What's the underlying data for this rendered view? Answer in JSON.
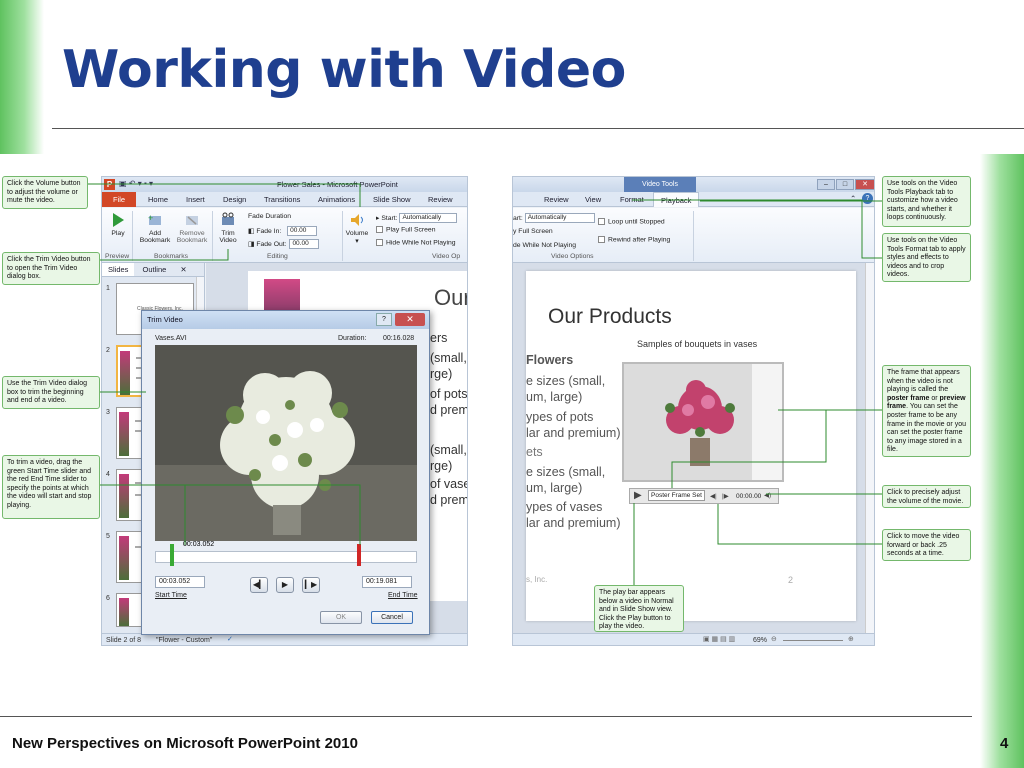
{
  "slide": {
    "title": "Working with Video",
    "footer": "New Perspectives on Microsoft PowerPoint 2010",
    "page_number": "4"
  },
  "left_window": {
    "title": "Flower Sales - Microsoft PowerPoint",
    "tabs": [
      "File",
      "Home",
      "Insert",
      "Design",
      "Transitions",
      "Animations",
      "Slide Show",
      "Review"
    ],
    "ribbon": {
      "play": "Play",
      "add_bookmark": [
        "Add",
        "Bookmark"
      ],
      "remove_bookmark": [
        "Remove",
        "Bookmark"
      ],
      "trim_video": [
        "Trim",
        "Video"
      ],
      "fade_duration": "Fade Duration",
      "fade_in": "Fade In:",
      "fade_in_value": "00.00",
      "fade_out": "Fade Out:",
      "fade_out_value": "00.00",
      "volume": "Volume",
      "start": "Start:",
      "start_value": "Automatically",
      "play_full_screen": "Play Full Screen",
      "hide_while_not_playing": "Hide While Not Playing",
      "groups": [
        "Preview",
        "Bookmarks",
        "Editing",
        "Video Op"
      ]
    },
    "pane_tabs": [
      "Slides",
      "Outline"
    ],
    "thumb_numbers": [
      "1",
      "2",
      "3",
      "4",
      "5",
      "6"
    ],
    "thumb1_text": "Classic Flowers, Inc.",
    "edit_slide_text": [
      "Our",
      "ers",
      "(small,",
      "rge)",
      "of pots",
      "d premi",
      "(small,",
      "rge)",
      "of vases",
      "d premi"
    ],
    "status": {
      "slide": "Slide 2 of 8",
      "theme": "\"Flower - Custom\""
    }
  },
  "trim_dialog": {
    "title": "Trim Video",
    "file": "Vases.AVI",
    "duration_label": "Duration:",
    "duration_value": "00:16.028",
    "slider_start_label": "00:03.052",
    "start_time_value": "00:03.052",
    "end_time_value": "00:19.081",
    "start_time_label": "Start Time",
    "end_time_label": "End Time",
    "ok": "OK",
    "cancel": "Cancel"
  },
  "right_window": {
    "video_tools": "Video Tools",
    "tabs": [
      "Review",
      "View",
      "Format",
      "Playback"
    ],
    "start_prefix": "art:",
    "start_value": "Automatically",
    "loop": "Loop until Stopped",
    "full_screen": "y Full Screen",
    "rewind": "Rewind after Playing",
    "hide": "de While Not Playing",
    "group": "Video Options",
    "slide_title": "Our Products",
    "slide_caption": "Samples of bouquets in vases",
    "slide_text": [
      "Flowers",
      "e sizes (small,",
      "um, large)",
      "ypes of pots",
      "lar and premium)",
      "ets",
      "e sizes (small,",
      "um, large)",
      "ypes of vases",
      "lar and premium)",
      "s, Inc."
    ],
    "slide_number": "2",
    "playbar_tooltip": "Poster Frame Set",
    "playbar_time": "00:00.00",
    "zoom": "69%"
  },
  "callouts": {
    "volume": "Click  the Volume button to adjust the volume or mute the video.",
    "trim_button": "Click the Trim Video button to open the Trim Video dialog box.",
    "trim_dialog": "Use the Trim Video dialog box to trim the beginning and end of a video.",
    "sliders": "To trim a video, drag the green Start Time slider and the red End Time slider to specify the points at which the video will start and stop playing.",
    "playback_tab": "Use tools on the Video Tools Playback tab to customize how a video starts, and whether it loops continuously.",
    "format_tab": "Use tools on the Video Tools Format tab to apply styles and effects to videos and to crop videos.",
    "poster_1": "The frame that appears when the video is not playing is called the ",
    "poster_bold_1": "poster frame",
    "poster_2": " or ",
    "poster_bold_2": "preview frame",
    "poster_3": ". You can set the poster frame to be any frame in the movie or you can set the poster frame to any image stored in a file.",
    "adjust_volume": "Click to precisely adjust the volume of the movie.",
    "move_video": "Click to move the video forward or back .25 seconds at a time.",
    "play_bar": "The play bar appears below a video in Normal and in Slide Show view. Click the Play button to play the video."
  },
  "colors": {
    "title_blue": "#1f3f8f",
    "accent_green": "#5fc25f",
    "callout_bg": "#e9f7e6",
    "file_tab": "#d24726"
  }
}
